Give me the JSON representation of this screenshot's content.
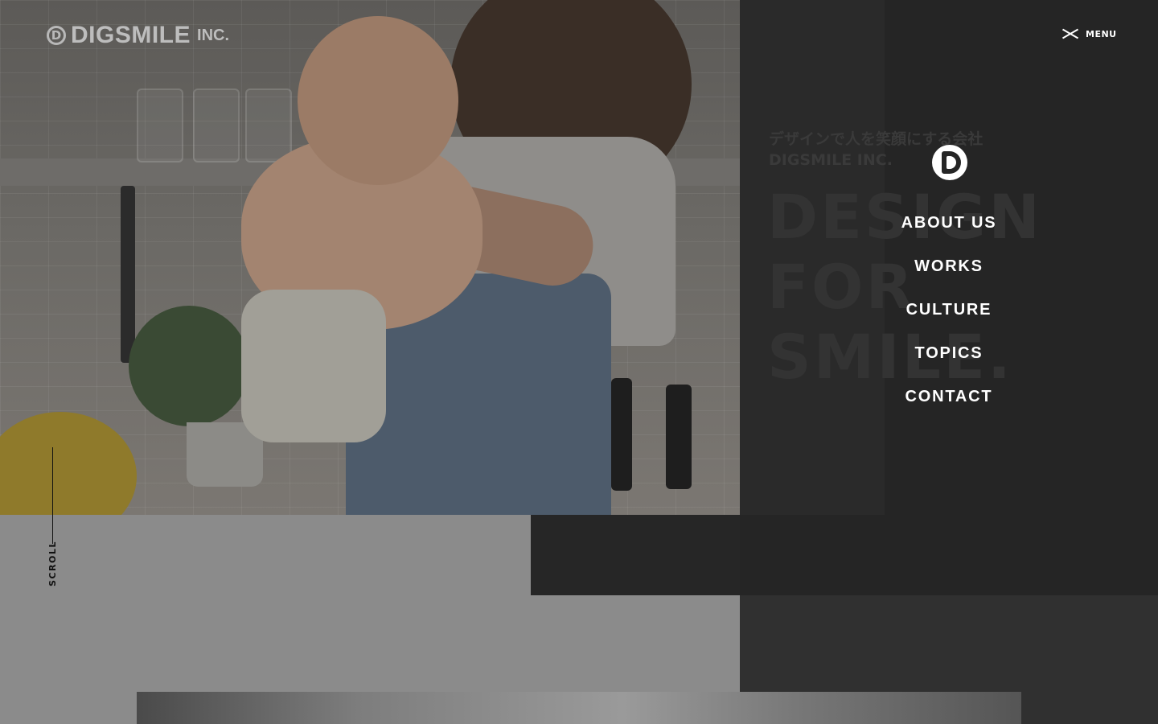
{
  "brand": {
    "logo_mark": "D",
    "name": "DIGSMILE",
    "suffix": "INC."
  },
  "hero": {
    "tagline_ja": "デザインで人を笑顔にする会社",
    "tagline_en": "DIGSMILE INC.",
    "headline": [
      "DESIGN",
      "FOR",
      "SMILE."
    ]
  },
  "scroll_label": "SCROLL",
  "menu": {
    "close_label": "MENU",
    "items": [
      "ABOUT US",
      "WORKS",
      "CULTURE",
      "TOPICS",
      "CONTACT"
    ]
  },
  "colors": {
    "overlay_panel": "#252525",
    "menu_text": "#ffffff",
    "page_grey": "#8b8b8b"
  }
}
